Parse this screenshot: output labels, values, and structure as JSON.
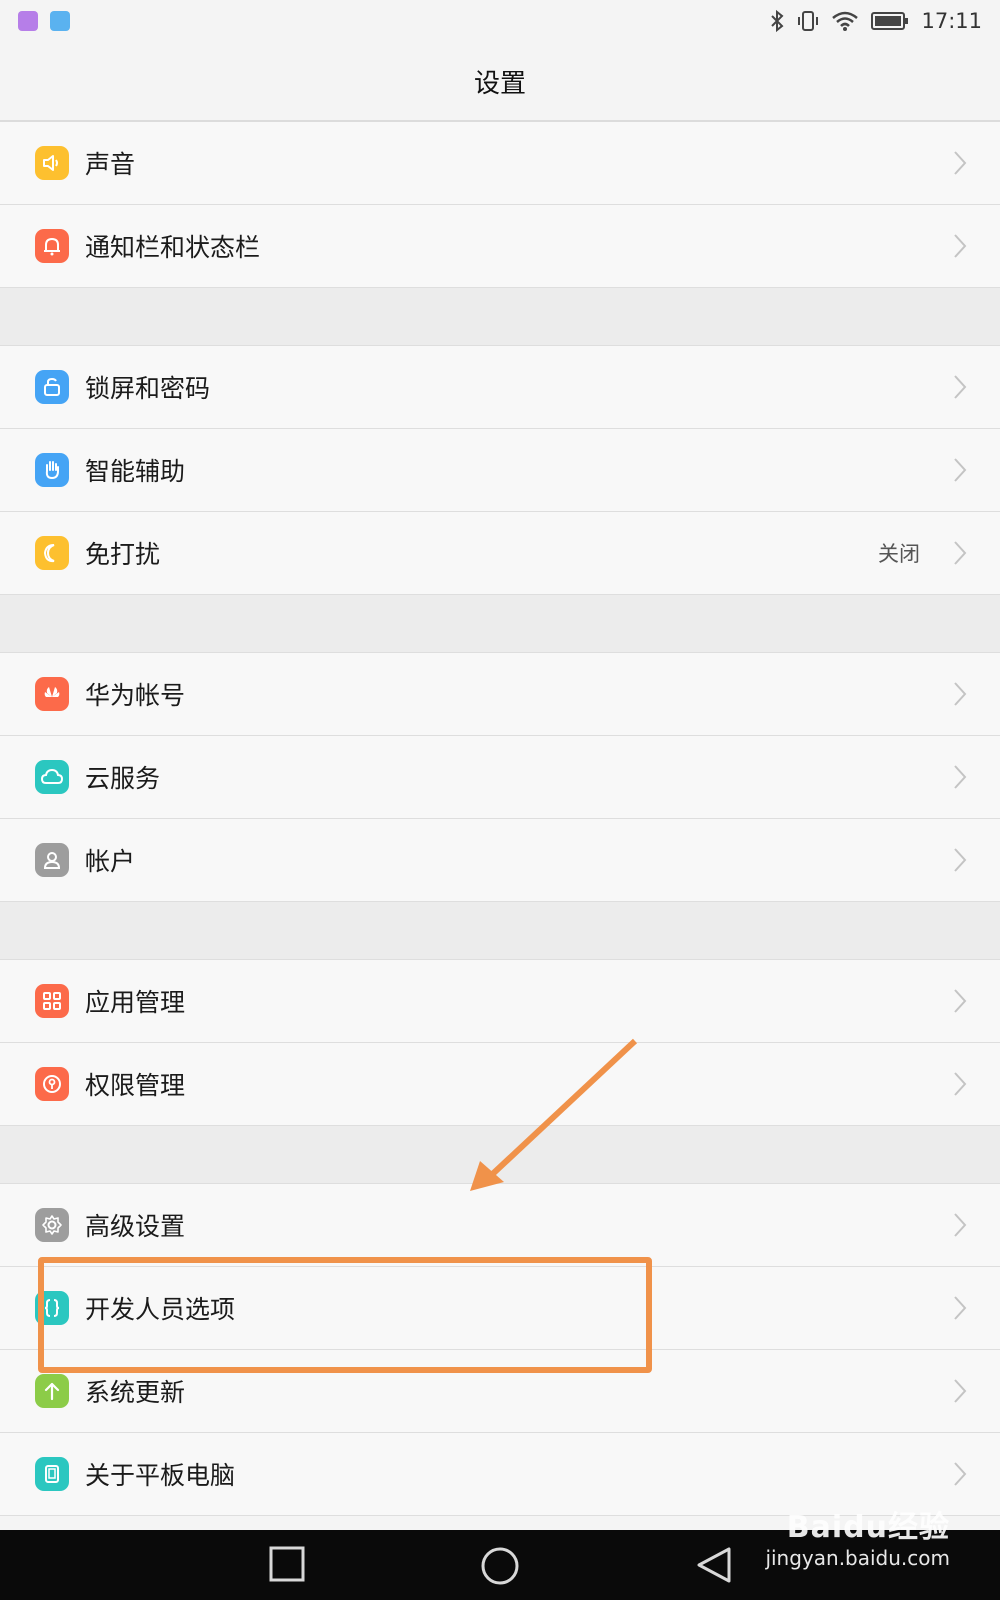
{
  "status_bar": {
    "time": "17:11",
    "icons": [
      "gallery-notification-icon",
      "app-notification-icon",
      "bluetooth-icon",
      "vibrate-icon",
      "wifi-icon",
      "battery-icon"
    ]
  },
  "header": {
    "title": "设置"
  },
  "groups": [
    [
      {
        "label": "声音",
        "icon": "speaker-icon",
        "color": "#fdc02f"
      },
      {
        "label": "通知栏和状态栏",
        "icon": "bell-icon",
        "color": "#fc6a4a"
      }
    ],
    [
      {
        "label": "锁屏和密码",
        "icon": "lock-icon",
        "color": "#45a4f5"
      },
      {
        "label": "智能辅助",
        "icon": "hand-icon",
        "color": "#45a4f5"
      },
      {
        "label": "免打扰",
        "icon": "moon-icon",
        "color": "#fdc02f",
        "value": "关闭"
      }
    ],
    [
      {
        "label": "华为帐号",
        "icon": "huawei-logo-icon",
        "color": "#fc6a4a"
      },
      {
        "label": "云服务",
        "icon": "cloud-icon",
        "color": "#2bc7c0"
      },
      {
        "label": "帐户",
        "icon": "person-icon",
        "color": "#9d9d9d"
      }
    ],
    [
      {
        "label": "应用管理",
        "icon": "apps-grid-icon",
        "color": "#fc6a4a"
      },
      {
        "label": "权限管理",
        "icon": "key-icon",
        "color": "#fc6a4a"
      }
    ],
    [
      {
        "label": "高级设置",
        "icon": "gear-icon",
        "color": "#9d9d9d"
      },
      {
        "label": "开发人员选项",
        "icon": "braces-icon",
        "color": "#2bc7c0"
      },
      {
        "label": "系统更新",
        "icon": "upload-arrow-icon",
        "color": "#8ccc48"
      },
      {
        "label": "关于平板电脑",
        "icon": "tablet-icon",
        "color": "#2bc7c0"
      }
    ]
  ],
  "nav_bar": {
    "buttons": [
      "recents-button",
      "home-button",
      "back-button"
    ]
  },
  "watermark": {
    "logo": "Baidu经验",
    "url": "jingyan.baidu.com"
  },
  "annotation": {
    "color": "#f0924a"
  }
}
